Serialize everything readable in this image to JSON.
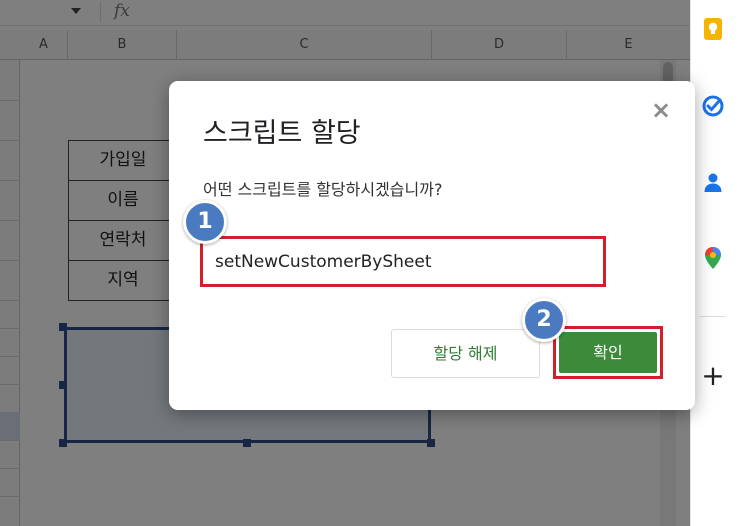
{
  "formula_bar": {
    "fx_label": "fx"
  },
  "sheet": {
    "columns": [
      "A",
      "B",
      "C",
      "D",
      "E"
    ],
    "table_labels": [
      "가입일",
      "이름",
      "연락처",
      "지역"
    ]
  },
  "dialog": {
    "title": "스크립트 할당",
    "question": "어떤 스크립트를 할당하시겠습니까?",
    "input_value": "setNewCustomerBySheet",
    "unassign_label": "할당 해제",
    "confirm_label": "확인",
    "close_glyph": "×"
  },
  "steps": {
    "step1": "1",
    "step2": "2"
  },
  "side_panel": {
    "icons": [
      "keep-icon",
      "tasks-icon",
      "contacts-icon",
      "maps-icon",
      "add-icon"
    ],
    "add_glyph": "+"
  },
  "colors": {
    "accent_green": "#3c8a3a",
    "highlight_red": "#d21f2b",
    "badge_blue": "#4a7bc0"
  }
}
